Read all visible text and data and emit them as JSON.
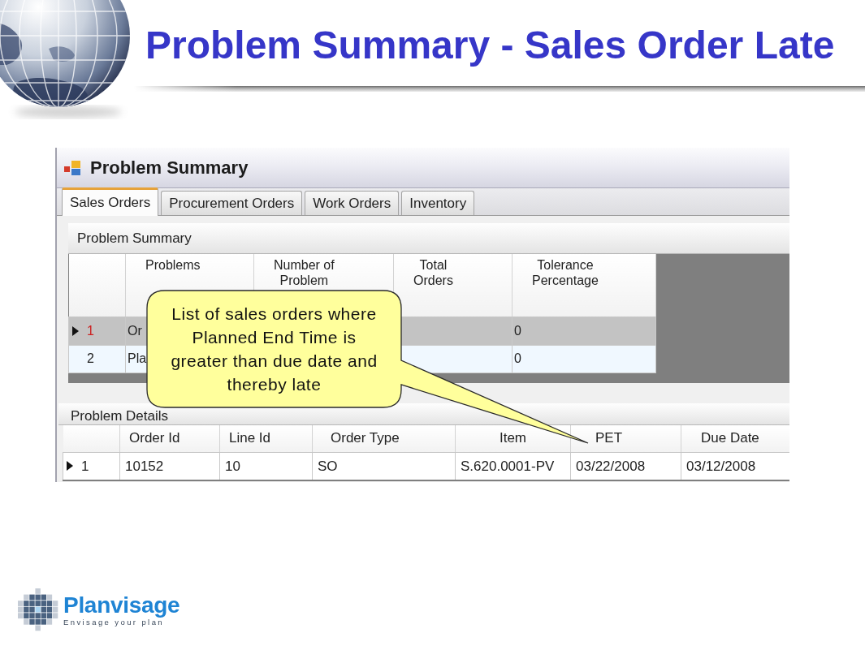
{
  "slide": {
    "title": "Problem Summary - Sales Order Late"
  },
  "window": {
    "title": "Problem Summary"
  },
  "tabs": [
    {
      "label": "Sales Orders",
      "selected": true
    },
    {
      "label": "Procurement Orders",
      "selected": false
    },
    {
      "label": "Work Orders",
      "selected": false
    },
    {
      "label": "Inventory",
      "selected": false
    }
  ],
  "problem_summary": {
    "heading": "Problem Summary",
    "columns": [
      "Problems",
      "Number of\nProblem",
      "Total\nOrders",
      "Tolerance\nPercentage"
    ],
    "rows": [
      {
        "row_header": "1",
        "current": true,
        "selected": true,
        "problems": "Or",
        "tolerance_percentage": "0"
      },
      {
        "row_header": "2",
        "current": false,
        "selected": false,
        "problems": "Pla",
        "tolerance_percentage": "0"
      }
    ]
  },
  "problem_details": {
    "heading": "Problem Details",
    "columns": [
      "Order Id",
      "Line Id",
      "Order Type",
      "Item",
      "PET",
      "Due Date"
    ],
    "rows": [
      {
        "row_header": "1",
        "current": true,
        "selected": false,
        "cells": [
          "10152",
          "10",
          "SO",
          "S.620.0001-PV",
          "03/22/2008",
          "03/12/2008"
        ]
      }
    ]
  },
  "callout": {
    "text": "List of sales orders where\nPlanned End Time is\ngreater than due date and\nthereby late"
  },
  "logo": {
    "name": "Planvisage",
    "tagline": "Envisage your plan"
  }
}
